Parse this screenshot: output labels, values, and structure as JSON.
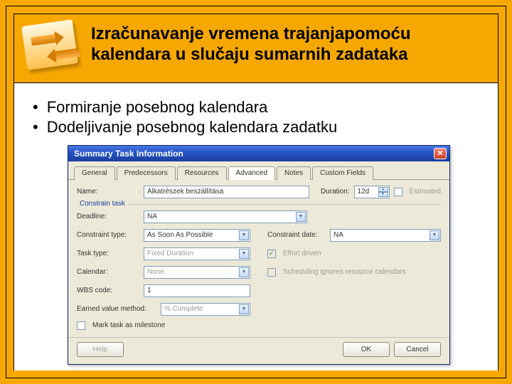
{
  "slide": {
    "title": "Izračunavanje vremena trajanjapomoću kalendara u slučaju sumarnih zadataka",
    "bullets": [
      "Formiranje posebnog kalendara",
      "Dodeljivanje posebnog kalendara zadatku"
    ]
  },
  "dialog": {
    "title": "Summary Task Information",
    "close_glyph": "✕",
    "tabs": [
      "General",
      "Predecessors",
      "Resources",
      "Advanced",
      "Notes",
      "Custom Fields"
    ],
    "active_tab": "Advanced",
    "name_label": "Name:",
    "name_value": "Alkatrészek beszállítása",
    "duration_label": "Duration:",
    "duration_value": "12d",
    "estimated_label": "Estimated",
    "constrain_section": "Constrain task",
    "deadline_label": "Deadline:",
    "deadline_value": "NA",
    "constraint_type_label": "Constraint type:",
    "constraint_type_value": "As Soon As Possible",
    "constraint_date_label": "Constraint date:",
    "constraint_date_value": "NA",
    "task_type_label": "Task type:",
    "task_type_value": "Fixed Duration",
    "effort_driven_label": "Effort driven",
    "calendar_label": "Calendar:",
    "calendar_value": "None",
    "scheduling_ignores_label": "Scheduling ignores resource calendars",
    "wbs_label": "WBS code:",
    "wbs_value": "1",
    "earned_label": "Earned value method:",
    "earned_value": "% Complete",
    "milestone_label": "Mark task as milestone",
    "buttons": {
      "help": "Help",
      "ok": "OK",
      "cancel": "Cancel"
    }
  }
}
